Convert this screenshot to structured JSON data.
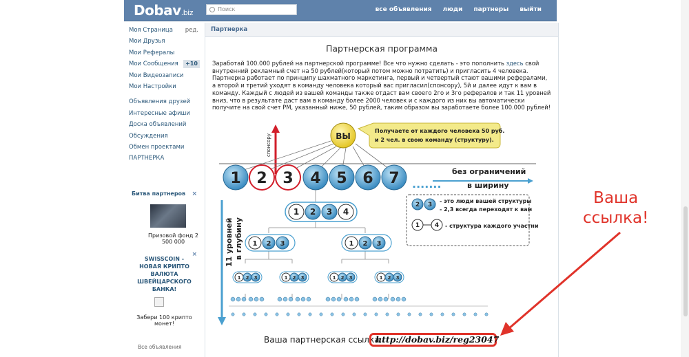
{
  "header": {
    "logo": "Dobav",
    "logo_suffix": ".biz",
    "search_placeholder": "Поиск",
    "nav": [
      "все объявления",
      "люди",
      "партнеры",
      "выйти"
    ]
  },
  "sidebar": {
    "items": [
      {
        "label": "Моя Страница",
        "extra": "ред."
      },
      {
        "label": "Мои Друзья"
      },
      {
        "label": "Мои Рефералы"
      },
      {
        "label": "Мои Сообщения",
        "badge": "+10"
      },
      {
        "label": "Мои Видеозаписи"
      },
      {
        "label": "Мои Настройки"
      }
    ],
    "items2": [
      {
        "label": "Объявления друзей"
      },
      {
        "label": "Интересные афиши"
      },
      {
        "label": "Доска объявлений"
      },
      {
        "label": "Обсуждения"
      },
      {
        "label": "Обмен проектами"
      },
      {
        "label": "ПАРТНЕРКА"
      }
    ],
    "promo1": {
      "title": "Битва партнеров",
      "text": "Призовой фонд 2 500 000"
    },
    "promo2": {
      "title": "SWISSCOIN - НОВАЯ КРИПТО ВАЛЮТА ШВЕЙЦАРСКОГО БАНКА!",
      "text": "Забери 100 крипто монет!"
    },
    "close": "×",
    "footer": "Все объявления"
  },
  "main": {
    "breadcrumb": "Партнерка",
    "title": "Партнерская программа",
    "text_before": "Заработай 100.000 рублей на партнерской программе! Все что нужно сделать - это пополнить ",
    "link": "здесь",
    "text_after": " свой внутренний рекламный счет на 50 рублей(который потом можно потратить) и пригласить 4 человека. Партнерка работает по принципу шахматного маркетинга, первый и четвертый стают вашими рефералами, а второй и третий уходят в команду человека который вас пригласил(спонсору), 5й и далее идут к вам в команду. Каждый с людей из вашей команды также отдаст вам своего 2го и 3го рефералов и так 11 уровней вниз, что в результате даст вам в команду более 2000 человек и с каждого из них вы автоматически получите на свой счет PM, указанный ниже, 50 рублей, таким образом вы заработаете более 100.000 рублей!",
    "ref_label": "Ваша партнерская ссылка:",
    "ref_link": "http://dobav.biz/reg23047"
  },
  "diagram": {
    "you": "ВЫ",
    "callout": "Получаете от каждого человека 50 руб. и 2 чел. в свою команду (структуру).",
    "callout_l1": "Получаете от каждого человека 50 руб.",
    "callout_l2": "и 2 чел. в свою команду (структуру).",
    "sponsor": "спонсору",
    "row": [
      "1",
      "2",
      "3",
      "4",
      "5",
      "6",
      "7"
    ],
    "dots": ".......",
    "unlimited_l1": "без ограничений",
    "unlimited_l2": "в ширину",
    "depth_l1": "11 уровней",
    "depth_l2": "в глубину",
    "legend_l1": "- это люди вашей структуры",
    "legend_l2": "- 2,3 всегда переходят к вам",
    "legend_l3": "- структура каждого участника",
    "sub4": [
      "1",
      "2",
      "3",
      "4"
    ],
    "sub3": [
      "1",
      "2",
      "3"
    ],
    "small_dots": "..."
  },
  "annotation": {
    "line1": "Ваша",
    "line2": "ссылка!"
  },
  "colors": {
    "header": "#5f82ab",
    "link": "#2b587a",
    "accent_red": "#e0332a",
    "circle_blue": "#4a9fd0",
    "callout": "#f3ea8a"
  }
}
